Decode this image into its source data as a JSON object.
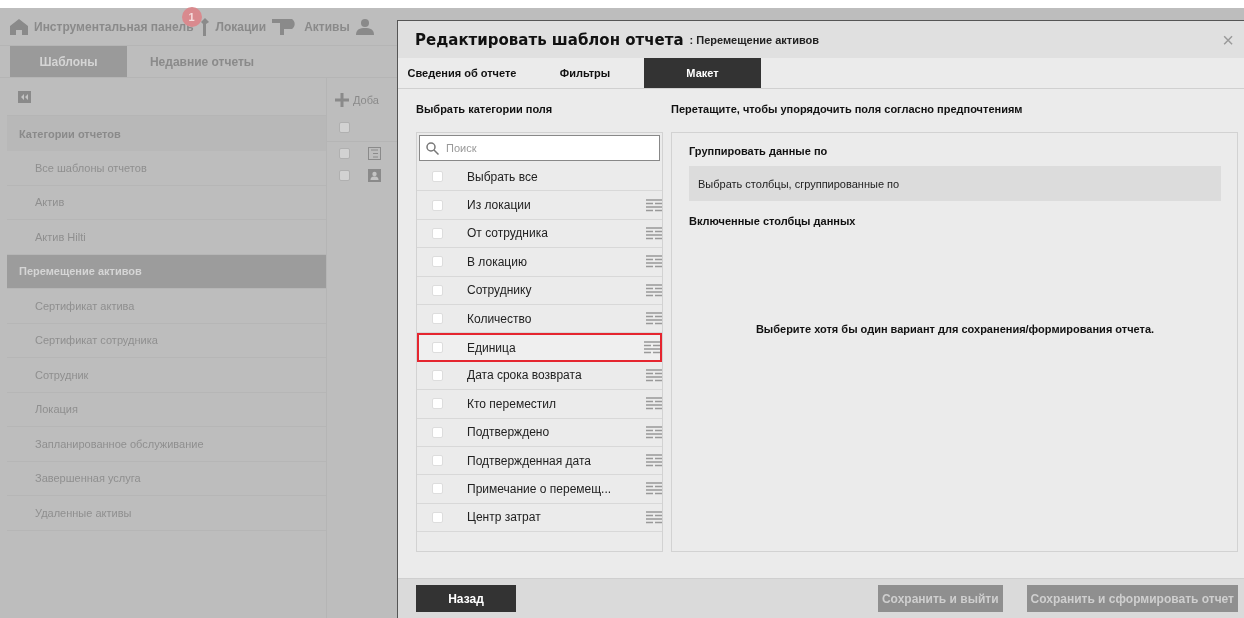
{
  "nav": {
    "items": [
      {
        "kind": "home",
        "label": "Инструментальная панель",
        "badge": "1"
      },
      {
        "kind": "location",
        "label": "Локации"
      },
      {
        "kind": "asset",
        "label": "Активы"
      },
      {
        "kind": "person"
      }
    ]
  },
  "page_tabs": [
    {
      "label": "Шаблоны",
      "selected": true
    },
    {
      "label": "Недавние отчеты",
      "selected": false
    }
  ],
  "sidebar": {
    "header": "Категории отчетов",
    "items": [
      {
        "label": "Все шаблоны отчетов",
        "selected": false
      },
      {
        "label": "Актив",
        "selected": false
      },
      {
        "label": "Актив Hilti",
        "selected": false
      },
      {
        "label": "Перемещение активов",
        "selected": true
      },
      {
        "label": "Сертификат актива",
        "selected": false
      },
      {
        "label": "Сертификат сотрудника",
        "selected": false
      },
      {
        "label": "Сотрудник",
        "selected": false
      },
      {
        "label": "Локация",
        "selected": false
      },
      {
        "label": "Запланированное обслуживание",
        "selected": false
      },
      {
        "label": "Завершенная услуга",
        "selected": false
      },
      {
        "label": "Удаленные активы",
        "selected": false
      }
    ]
  },
  "content": {
    "add_label": "Доба",
    "header_checked": false,
    "rows": [
      {
        "kind": "list",
        "checked": false
      },
      {
        "kind": "person",
        "checked": false
      }
    ]
  },
  "dialog": {
    "title": "Редактировать шаблон отчета",
    "subtitle": ": Перемещение активов",
    "close": "×",
    "tabs": [
      {
        "label": "Сведения об отчете",
        "selected": false
      },
      {
        "label": "Фильтры",
        "selected": false
      },
      {
        "label": "Макет",
        "selected": true
      }
    ],
    "left_heading": "Выбрать категории поля",
    "right_heading": "Перетащите, чтобы упорядочить поля согласно предпочтениям",
    "search": {
      "placeholder": "Поиск"
    },
    "select_all": {
      "label": "Выбрать все",
      "checked": false
    },
    "fields": [
      {
        "label": "Из локации",
        "checked": false,
        "highlighted": false
      },
      {
        "label": "От сотрудника",
        "checked": false,
        "highlighted": false
      },
      {
        "label": "В локацию",
        "checked": false,
        "highlighted": false
      },
      {
        "label": "Сотруднику",
        "checked": false,
        "highlighted": false
      },
      {
        "label": "Количество",
        "checked": false,
        "highlighted": false
      },
      {
        "label": "Единица",
        "checked": false,
        "highlighted": true
      },
      {
        "label": "Дата срока возврата",
        "checked": false,
        "highlighted": false
      },
      {
        "label": "Кто переместил",
        "checked": false,
        "highlighted": false
      },
      {
        "label": "Подтверждено",
        "checked": false,
        "highlighted": false
      },
      {
        "label": "Подтвержденная дата",
        "checked": false,
        "highlighted": false
      },
      {
        "label": "Примечание о перемещ...",
        "checked": false,
        "highlighted": false
      },
      {
        "label": "Центр затрат",
        "checked": false,
        "highlighted": false
      }
    ],
    "group_heading": "Группировать данные по",
    "group_placeholder": "Выбрать столбцы, сгруппированные по",
    "columns_heading": "Включенные столбцы данных",
    "empty_message": "Выберите хотя бы один вариант для сохранения/формирования отчета.",
    "buttons": [
      {
        "label": "Назад",
        "disabled": false
      },
      {
        "label": "Сохранить и выйти",
        "disabled": true
      },
      {
        "label": "Сохранить и сформировать отчет",
        "disabled": true
      }
    ]
  }
}
